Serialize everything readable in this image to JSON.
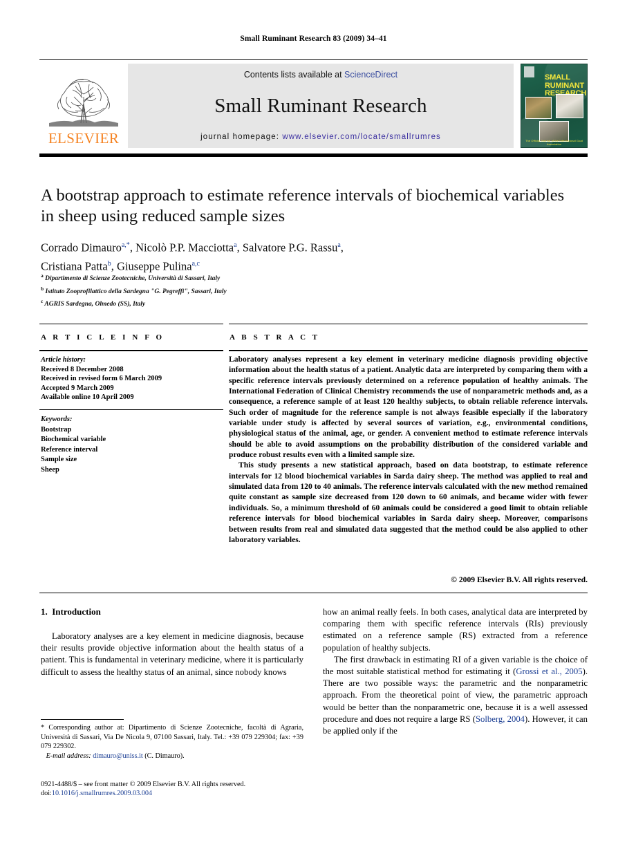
{
  "running_head": "Small Ruminant Research 83 (2009) 34–41",
  "masthead": {
    "publisher": "ELSEVIER",
    "contents_prefix": "Contents lists available at ",
    "contents_link": "ScienceDirect",
    "journal_name": "Small Ruminant Research",
    "homepage_label": "journal homepage: ",
    "homepage_url": "www.elsevier.com/locate/smallrumres",
    "cover": {
      "title_line1": "SMALL",
      "title_line2": "RUMINANT",
      "title_line3": "RESEARCH",
      "footer": "The Official Journal of the International Goat Association"
    }
  },
  "article": {
    "title": "A bootstrap approach to estimate reference intervals of biochemical variables in sheep using reduced sample sizes",
    "authors_line1_a": "Corrado Dimauro",
    "authors_line1_a_sup": "a,*",
    "authors_line1_b": ", Nicolò P.P. Macciotta",
    "authors_line1_b_sup": "a",
    "authors_line1_c": ", Salvatore P.G. Rassu",
    "authors_line1_c_sup": "a",
    "authors_line1_end": ",",
    "authors_line2_a": "Cristiana Patta",
    "authors_line2_a_sup": "b",
    "authors_line2_b": ", Giuseppe Pulina",
    "authors_line2_b_sup": "a,c",
    "affiliations": [
      {
        "mark": "a",
        "text": "Dipartimento di Scienze Zootecniche, Università di Sassari, Italy"
      },
      {
        "mark": "b",
        "text": "Istituto Zooprofilattico della Sardegna \"G. Pegreffi\", Sassari, Italy"
      },
      {
        "mark": "c",
        "text": "AGRIS Sardegna, Olmedo (SS), Italy"
      }
    ]
  },
  "info": {
    "header": "A R T I C L E  I N F O",
    "history_label": "Article history:",
    "history": [
      "Received 8 December 2008",
      "Received in revised form 6 March 2009",
      "Accepted 9 March 2009",
      "Available online 10 April 2009"
    ],
    "keywords_label": "Keywords:",
    "keywords": [
      "Bootstrap",
      "Biochemical variable",
      "Reference interval",
      "Sample size",
      "Sheep"
    ]
  },
  "abstract": {
    "header": "A B S T R A C T",
    "paragraph1": "Laboratory analyses represent a key element in veterinary medicine diagnosis providing objective information about the health status of a patient. Analytic data are interpreted by comparing them with a specific reference intervals previously determined on a reference population of healthy animals. The International Federation of Clinical Chemistry recommends the use of nonparametric methods and, as a consequence, a reference sample of at least 120 healthy subjects, to obtain reliable reference intervals. Such order of magnitude for the reference sample is not always feasible especially if the laboratory variable under study is affected by several sources of variation, e.g., environmental conditions, physiological status of the animal, age, or gender. A convenient method to estimate reference intervals should be able to avoid assumptions on the probability distribution of the considered variable and produce robust results even with a limited sample size.",
    "paragraph2": "This study presents a new statistical approach, based on data bootstrap, to estimate reference intervals for 12 blood biochemical variables in Sarda dairy sheep. The method was applied to real and simulated data from 120 to 40 animals. The reference intervals calculated with the new method remained quite constant as sample size decreased from 120 down to 60 animals, and became wider with fewer individuals. So, a minimum threshold of 60 animals could be considered a good limit to obtain reliable reference intervals for blood biochemical variables in Sarda dairy sheep. Moreover, comparisons between results from real and simulated data suggested that the method could be also applied to other laboratory variables.",
    "copyright": "© 2009 Elsevier B.V. All rights reserved."
  },
  "body": {
    "section_number": "1.",
    "section_title": "Introduction",
    "left_paragraph": "Laboratory analyses are a key element in medicine diagnosis, because their results provide objective information about the health status of a patient. This is fundamental in veterinary medicine, where it is particularly difficult to assess the healthy status of an animal, since nobody knows",
    "right_paragraph1": "how an animal really feels. In both cases, analytical data are interpreted by comparing them with specific reference intervals (RIs) previously estimated on a reference sample (RS) extracted from a reference population of healthy subjects.",
    "right_paragraph2_a": "The first drawback in estimating RI of a given variable is the choice of the most suitable statistical method for estimating it (",
    "right_cite1": "Grossi et al., 2005",
    "right_paragraph2_b": "). There are two possible ways: the parametric and the nonparametric approach. From the theoretical point of view, the parametric approach would be better than the nonparametric one, because it is a well assessed procedure and does not require a large RS (",
    "right_cite2": "Solberg, 2004",
    "right_paragraph2_c": "). However, it can be applied only if the"
  },
  "footnotes": {
    "corresponding": "* Corresponding author at: Dipartimento di Scienze Zootecniche, facoltà di Agraria, Università di Sassari, Via De Nicola 9, 07100 Sassari, Italy. Tel.: +39 079 229304; fax: +39 079 229302.",
    "email_label": "E-mail address:",
    "email": "dimauro@uniss.it",
    "email_owner": "(C. Dimauro).",
    "issn_line": "0921-4488/$ – see front matter © 2009 Elsevier B.V. All rights reserved.",
    "doi_label": "doi:",
    "doi": "10.1016/j.smallrumres.2009.03.004"
  },
  "colors": {
    "elsevier_orange": "#F58220",
    "link_blue": "#1c3f94",
    "sciencedirect_blue": "#3b4ea0",
    "cover_green": "#1d5c46",
    "cover_yellow": "#f2e53d"
  }
}
